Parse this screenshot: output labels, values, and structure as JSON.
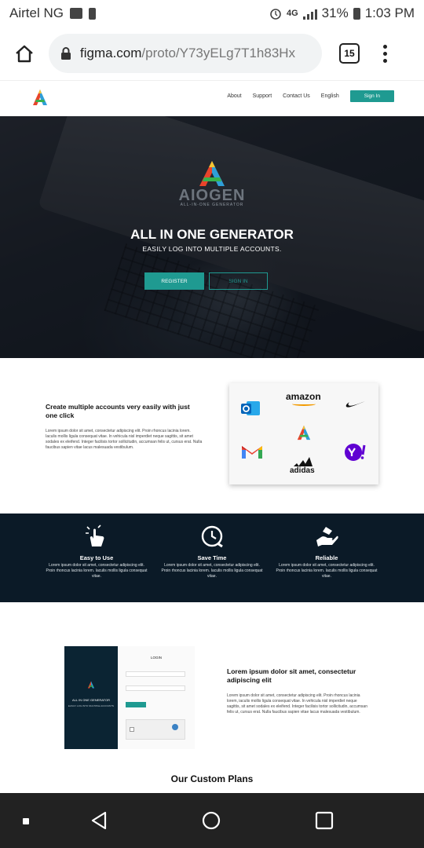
{
  "status_bar": {
    "carrier": "Airtel NG",
    "network": "4G",
    "battery": "31%",
    "time": "1:03 PM"
  },
  "browser": {
    "url_domain": "figma.com",
    "url_path": "/proto/Y73yELg7T1h83Hx",
    "tab_count": "15"
  },
  "site_nav": {
    "items": [
      "About",
      "Support",
      "Contact Us",
      "English"
    ],
    "signin": "Sign In"
  },
  "hero": {
    "brand": "AIOGEN",
    "brand_sub": "ALL-IN-ONE GENERATOR",
    "title": "ALL IN ONE GENERATOR",
    "subtitle": "EASILY LOG INTO MULTIPLE ACCOUNTS.",
    "register": "REGISTER",
    "signin": "SIGN IN"
  },
  "section1": {
    "heading": "Create multiple accounts very easily with just one click",
    "body": "Lorem ipsum dolor sit amet, consectetur adipiscing elit. Proin rhoncus lacinia lorem. Iaculis mollis ligula consequat vitae. In vehicula nisl imperdiet neque sagittis, sit amet sodales ex eleifend. Integer facilisis tortor sollicitudin, accumsan felis ut, cursus erat. Nulla faucibus sapien vitae lacus malesuada vestibulum.",
    "brands": {
      "amazon": "amazon",
      "adidas": "adidas"
    }
  },
  "features": [
    {
      "title": "Easy to Use",
      "desc": "Lorem ipsum dolor sit amet, consectetur adipiscing elit. Proin rhoncus lacinia lorem. Iaculis mollis ligula consequat vitae.",
      "icon": "hand-tap-icon"
    },
    {
      "title": "Save Time",
      "desc": "Lorem ipsum dolor sit amet, consectetur adipiscing elit. Proin rhoncus lacinia lorem. Iaculis mollis ligula consequat vitae.",
      "icon": "clock-icon"
    },
    {
      "title": "Reliable",
      "desc": "Lorem ipsum dolor sit amet, consectetur adipiscing elit. Proin rhoncus lacinia lorem. Iaculis mollis ligula consequat vitae.",
      "icon": "hand-giving-icon"
    }
  ],
  "login_preview": {
    "title": "ALL IN ONE GENERATOR",
    "subtitle": "EASILY LOG INTO MULTIPLE ACCOUNTS",
    "login": "LOGIN"
  },
  "section2": {
    "heading": "Lorem ipsum dolor sit amet, consectetur adipiscing elit",
    "body": "Lorem ipsum dolor sit amet, consectetur adipiscing elit. Proin rhoncus lacinia lorem, iaculis mollis ligula consequat vitae. In vehicula nisl imperdiet neque sagittis, sit amet sodales ex eleifend. Integer facilisis tortor sollicitudin, accumsan felis ut, cursus erat. Nulla faucibus sapien vitae lacus malesuada vestibulum."
  },
  "plans_heading": "Our Custom Plans",
  "colors": {
    "accent": "#1f9a91",
    "dark_band": "#0b1a27"
  }
}
